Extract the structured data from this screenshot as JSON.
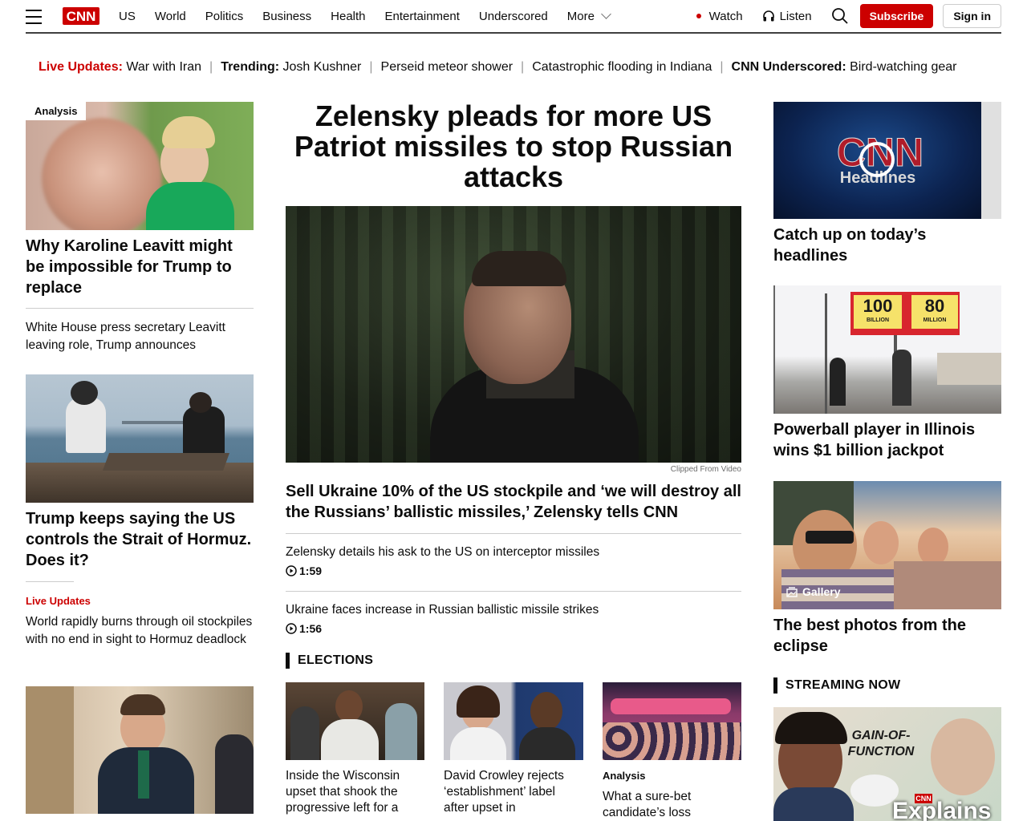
{
  "header": {
    "logo_text": "CNN",
    "nav": [
      "US",
      "World",
      "Politics",
      "Business",
      "Health",
      "Entertainment",
      "Underscored",
      "More"
    ],
    "watch_label": "Watch",
    "listen_label": "Listen",
    "subscribe_label": "Subscribe",
    "signin_label": "Sign in"
  },
  "trending": {
    "live_label": "Live Updates:",
    "live_text": "War with Iran",
    "trending_label": "Trending:",
    "items": [
      "Josh Kushner",
      "Perseid meteor shower",
      "Catastrophic flooding in Indiana"
    ],
    "underscored_label": "CNN Underscored:",
    "underscored_text": "Bird-watching gear"
  },
  "left": {
    "story1": {
      "tag": "Analysis",
      "headline": "Why Karoline Leavitt might be impossible for Trump to replace",
      "sub": "White House press secretary Leavitt leaving role, Trump announces"
    },
    "story2": {
      "headline": "Trump keeps saying the US controls the Strait of Hormuz. Does it?",
      "live_label": "Live Updates",
      "sub": "World rapidly burns through oil stockpiles with no end in sight to Hormuz deadlock"
    }
  },
  "center": {
    "headline": "Zelensky pleads for more US Patriot missiles to stop Russian attacks",
    "caption": "Clipped From Video",
    "subhead": "Sell Ukraine 10% of the US stockpile and ‘we will destroy all the Russians’ ballistic missiles,’ Zelensky tells CNN",
    "videos": [
      {
        "title": "Zelensky details his ask to the US on interceptor missiles",
        "duration": "1:59"
      },
      {
        "title": "Ukraine faces increase in Russian ballistic missile strikes",
        "duration": "1:56"
      }
    ],
    "elections_title": "ELECTIONS",
    "elections": [
      {
        "tag": "",
        "text": "Inside the Wisconsin upset that shook the progressive left for a"
      },
      {
        "tag": "",
        "text": "David Crowley rejects ‘establishment’ label after upset in"
      },
      {
        "tag": "Analysis",
        "text": "What a sure-bet candidate’s loss"
      }
    ]
  },
  "right": {
    "video_overlay": "Headlines",
    "story1": "Catch up on today’s headlines",
    "billboard_left": "100",
    "billboard_left_sub": "BILLION",
    "billboard_right": "80",
    "billboard_right_sub": "MILLION",
    "story2": "Powerball player in Illinois wins $1 billion jackpot",
    "gallery_label": "Gallery",
    "story3": "The best photos from the eclipse",
    "streaming_title": "STREAMING NOW",
    "streaming_overlay": "GAIN-OF-FUNCTION",
    "streaming_brand": "Explains"
  },
  "colors": {
    "cnn_red": "#cc0000",
    "text": "#0c0c0c",
    "divider": "#cccccc"
  }
}
